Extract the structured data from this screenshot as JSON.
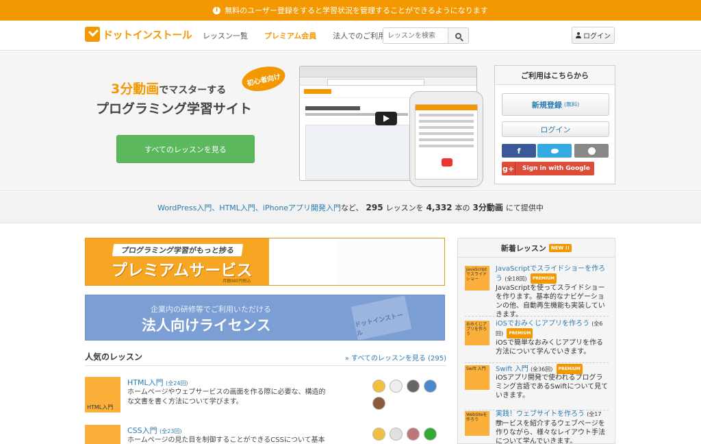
{
  "notice": {
    "text": "無料のユーザー登録をすると学習状況を管理することができるようになります"
  },
  "header": {
    "logo_text": "ドットインストール",
    "nav": [
      "レッスン一覧",
      "プレミアム会員",
      "法人でのご利用"
    ],
    "search_placeholder": "レッスンを検索",
    "login_label": "ログイン"
  },
  "hero": {
    "line1_highlight": "3分動画",
    "line1_rest": "でマスターする",
    "line2": "プログラミング学習サイト",
    "beginner_badge": "初心者向け",
    "cta_label": "すべてのレッスンを見る"
  },
  "signup_box": {
    "title": "ご利用はこちらから",
    "register_label": "新規登録",
    "register_note": "(無料)",
    "login_label": "ログイン",
    "facebook_label": "f",
    "google_mark": "g+",
    "google_label": "Sign in with Google"
  },
  "stats": {
    "topics": "WordPress入門、HTML入門、iPhoneアプリ開発入門",
    "prefix": "など、",
    "lesson_count": "295",
    "lesson_unit": "レッスンを",
    "video_count": "4,332",
    "video_unit": "本の",
    "video_label": "3分動画",
    "suffix": "にて提供中"
  },
  "premium_banner": {
    "ribbon": "プログラミング学習がもっと捗る",
    "title": "プレミアムサービス",
    "price": "月額980円税込"
  },
  "corporate_banner": {
    "sub": "企業内の研修等でご利用いただける",
    "title": "法人向けライセンス",
    "stamp": "ドットインストール"
  },
  "popular": {
    "heading": "人気のレッスン",
    "more_link": "» すべてのレッスンを見る (295)",
    "lessons": [
      {
        "thumb": "HTML\n入門",
        "title": "HTML入門",
        "count": "(全24回)",
        "desc": "ホームページやウェブサービスの画面を作る際に必要な、構造的な文書を書く方法について学びます。"
      },
      {
        "thumb": "",
        "title": "CSS入門",
        "count": "(全23回)",
        "desc": "ホームページの見た目を制御することができるCSSについて基本的な使い方"
      }
    ]
  },
  "new_lessons": {
    "heading": "新着レッスン",
    "badge": "NEW !!",
    "items": [
      {
        "thumb": "JavaScriptでスライドショー",
        "title": "JavaScriptでスライドショーを作ろう",
        "count": "(全18回)",
        "premium": "PREMIUM",
        "desc": "JavaScriptを使ってスライドショーを作ります。基本的なナビゲーションの他、自動再生機能も実装していきます。"
      },
      {
        "thumb": "おみくじアプリを作ろう",
        "title": "iOSでおみくじアプリを作ろう",
        "count": "(全6回)",
        "premium": "PREMIUM",
        "desc": "iOSで簡単なおみくじアプリを作る方法について学んでいきます。"
      },
      {
        "thumb": "Swift 入門",
        "title": "Swift 入門",
        "count": "(全36回)",
        "premium": "PREMIUM",
        "desc": "iOSアプリ開発で使われるプログラミング言語であるSwiftについて見ていきます。"
      },
      {
        "thumb": "WebSiteを作ろう",
        "title": "実践！ウェブサイトを作ろう",
        "count": "(全17回)",
        "premium": "",
        "desc": "サービスを紹介するウェブページを作りながら、様々なレイアウト手法について学んでいきます。"
      }
    ]
  }
}
